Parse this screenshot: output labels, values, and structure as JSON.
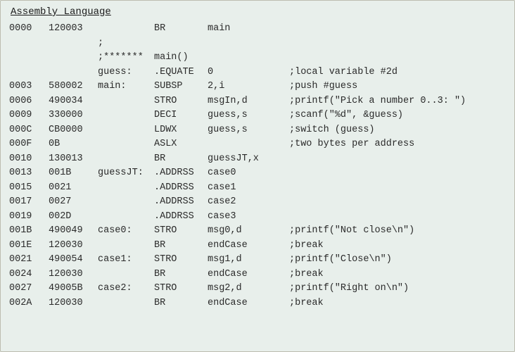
{
  "title": "Assembly Language",
  "rows": [
    {
      "addr": "0000",
      "obj": "120003",
      "label": "",
      "mnem": "BR",
      "oper": "main",
      "comm": ""
    },
    {
      "addr": "",
      "obj": "",
      "label": ";",
      "mnem": "",
      "oper": "",
      "comm": ""
    },
    {
      "addr": "",
      "obj": "",
      "label": ";*******",
      "mnem": "main()",
      "oper": "",
      "comm": ""
    },
    {
      "addr": "",
      "obj": "",
      "label": "guess:",
      "mnem": ".EQUATE",
      "oper": "0",
      "comm": ";local variable #2d"
    },
    {
      "addr": "0003",
      "obj": "580002",
      "label": "main:",
      "mnem": "SUBSP",
      "oper": "2,i",
      "comm": ";push #guess"
    },
    {
      "addr": "0006",
      "obj": "490034",
      "label": "",
      "mnem": "STRO",
      "oper": "msgIn,d",
      "comm": ";printf(\"Pick a number 0..3: \")"
    },
    {
      "addr": "0009",
      "obj": "330000",
      "label": "",
      "mnem": "DECI",
      "oper": "guess,s",
      "comm": ";scanf(\"%d\", &guess)"
    },
    {
      "addr": "000C",
      "obj": "CB0000",
      "label": "",
      "mnem": "LDWX",
      "oper": "guess,s",
      "comm": ";switch (guess)"
    },
    {
      "addr": "000F",
      "obj": "0B",
      "label": "",
      "mnem": "ASLX",
      "oper": "",
      "comm": ";two bytes per address"
    },
    {
      "addr": "0010",
      "obj": "130013",
      "label": "",
      "mnem": "BR",
      "oper": "guessJT,x",
      "comm": ""
    },
    {
      "addr": "0013",
      "obj": "001B",
      "label": "guessJT:",
      "mnem": ".ADDRSS",
      "oper": "case0",
      "comm": ""
    },
    {
      "addr": "0015",
      "obj": "0021",
      "label": "",
      "mnem": ".ADDRSS",
      "oper": "case1",
      "comm": ""
    },
    {
      "addr": "0017",
      "obj": "0027",
      "label": "",
      "mnem": ".ADDRSS",
      "oper": "case2",
      "comm": ""
    },
    {
      "addr": "0019",
      "obj": "002D",
      "label": "",
      "mnem": ".ADDRSS",
      "oper": "case3",
      "comm": ""
    },
    {
      "addr": "001B",
      "obj": "490049",
      "label": "case0:",
      "mnem": "STRO",
      "oper": "msg0,d",
      "comm": ";printf(\"Not close\\n\")"
    },
    {
      "addr": "001E",
      "obj": "120030",
      "label": "",
      "mnem": "BR",
      "oper": "endCase",
      "comm": ";break"
    },
    {
      "addr": "0021",
      "obj": "490054",
      "label": "case1:",
      "mnem": "STRO",
      "oper": "msg1,d",
      "comm": ";printf(\"Close\\n\")"
    },
    {
      "addr": "0024",
      "obj": "120030",
      "label": "",
      "mnem": "BR",
      "oper": "endCase",
      "comm": ";break"
    },
    {
      "addr": "0027",
      "obj": "49005B",
      "label": "case2:",
      "mnem": "STRO",
      "oper": "msg2,d",
      "comm": ";printf(\"Right on\\n\")"
    },
    {
      "addr": "002A",
      "obj": "120030",
      "label": "",
      "mnem": "BR",
      "oper": "endCase",
      "comm": ";break"
    }
  ]
}
